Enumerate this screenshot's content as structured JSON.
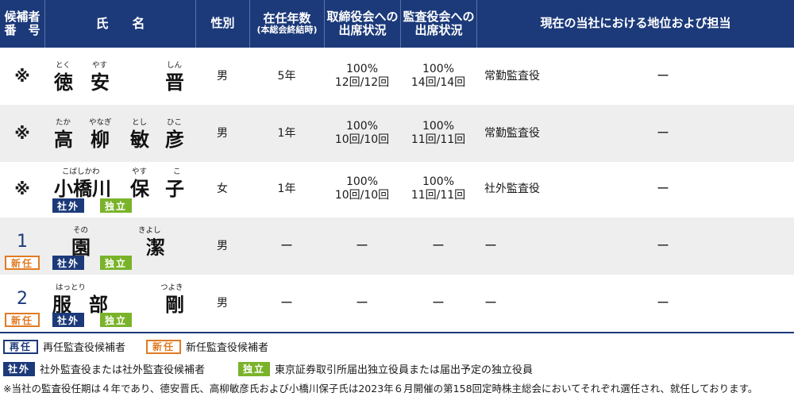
{
  "header": {
    "col_no": [
      "候補者",
      "番　号"
    ],
    "col_name": "氏名",
    "col_gender": "性別",
    "col_tenure": "在任年数",
    "col_tenure_sub": "(本総会終結時)",
    "col_board": [
      "取締役会への",
      "出席状況"
    ],
    "col_audit": [
      "監査役会への",
      "出席状況"
    ],
    "col_position": "現在の当社における地位および担当"
  },
  "rows": [
    {
      "no": "※",
      "name_kanji": [
        "徳",
        "安",
        "晋"
      ],
      "ruby": [
        "とく",
        "やす",
        "しん"
      ],
      "gender": "男",
      "tenure": "5年",
      "board_pct": "100%",
      "board_count": "12回/12回",
      "audit_pct": "100%",
      "audit_count": "14回/14回",
      "position": "常勤監査役",
      "duty": "ー"
    },
    {
      "no": "※",
      "name_kanji": [
        "高",
        "柳",
        "敏",
        "彦"
      ],
      "ruby": [
        "たか",
        "やなぎ",
        "とし",
        "ひこ"
      ],
      "gender": "男",
      "tenure": "1年",
      "board_pct": "100%",
      "board_count": "10回/10回",
      "audit_pct": "100%",
      "audit_count": "11回/11回",
      "position": "常勤監査役",
      "duty": "ー"
    },
    {
      "no": "※",
      "name_kanji": [
        "小橋川",
        "保",
        "子"
      ],
      "ruby": [
        "こばしかわ",
        "やす",
        "こ"
      ],
      "gender": "女",
      "tenure": "1年",
      "board_pct": "100%",
      "board_count": "10回/10回",
      "audit_pct": "100%",
      "audit_count": "11回/11回",
      "position": "社外監査役",
      "duty": "ー",
      "badges": [
        "社外",
        "独立"
      ]
    },
    {
      "no": "1",
      "name_kanji": [
        "園",
        "潔"
      ],
      "ruby": [
        "その",
        "きよし"
      ],
      "gender": "男",
      "tenure": "ー",
      "board": "ー",
      "audit": "ー",
      "position": "ー",
      "duty": "ー",
      "new_badge": "新任",
      "badges": [
        "社外",
        "独立"
      ]
    },
    {
      "no": "2",
      "name_kanji": [
        "服",
        "部",
        "剛"
      ],
      "ruby": [
        "はっとり",
        "つよき"
      ],
      "gender": "男",
      "tenure": "ー",
      "board": "ー",
      "audit": "ー",
      "position": "ー",
      "duty": "ー",
      "new_badge": "新任",
      "badges": [
        "社外",
        "独立"
      ]
    }
  ],
  "legend": {
    "re_badge": "再任",
    "re_text": "再任監査役候補者",
    "new_badge": "新任",
    "new_text": "新任監査役候補者",
    "out_badge": "社外",
    "out_text": "社外監査役または社外監査役候補者",
    "ind_badge": "独立",
    "ind_text": "東京証券取引所届出独立役員または届出予定の独立役員"
  },
  "note": "※当社の監査役任期は４年であり、德安晋氏、高柳敏彦氏および小橋川保子氏は2023年６月開催の第158回定時株主総会においてそれぞれ選任され、就任しております。",
  "colors": {
    "navy": "#1c3a7a",
    "green": "#7ab32a",
    "orange": "#e07b24",
    "shade": "#eeeeee"
  }
}
